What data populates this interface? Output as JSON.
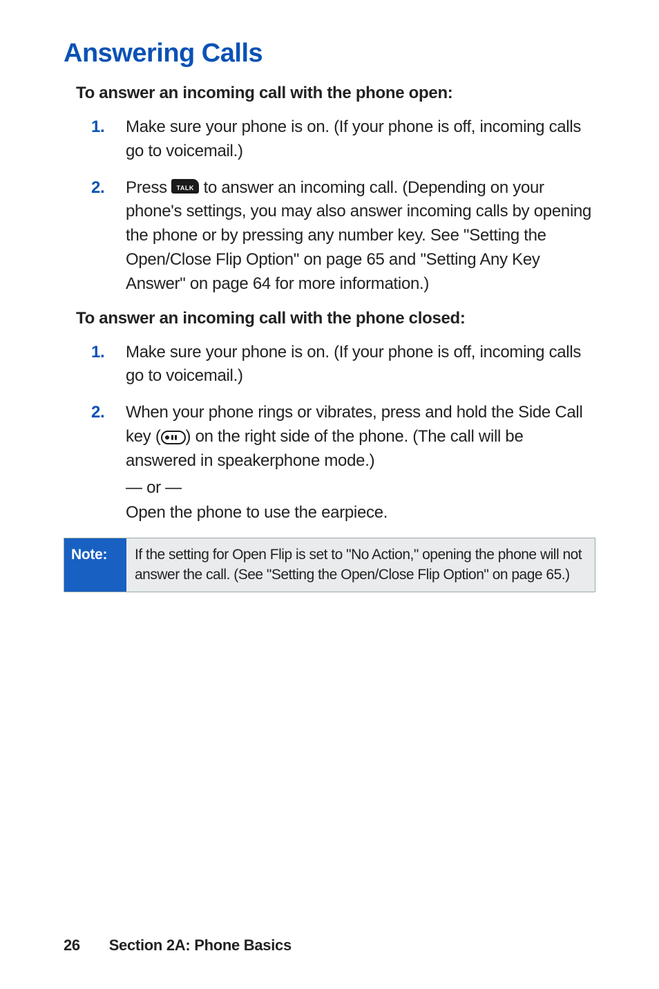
{
  "title": "Answering Calls",
  "sectionA": {
    "heading": "To answer an incoming call with the phone open:",
    "steps": [
      {
        "num": "1.",
        "text": "Make sure your phone is on. (If your phone is off, incoming calls go to voicemail.)"
      },
      {
        "num": "2.",
        "pre": "Press ",
        "post": " to answer an incoming call. (Depending on your phone's settings, you may also answer incoming calls by opening the phone or by pressing any number key. See \"Setting the Open/Close Flip Option\" on page 65 and \"Setting Any Key Answer\" on page 64 for more information.)"
      }
    ]
  },
  "sectionB": {
    "heading": "To answer an incoming call with the phone closed:",
    "steps": [
      {
        "num": "1.",
        "text": "Make sure your phone is on. (If your phone is off, incoming calls go to voicemail.)"
      },
      {
        "num": "2.",
        "pre": "When your phone rings or vibrates, press and hold the Side Call key (",
        "post": ") on the right side of the phone. (The call will be answered in speakerphone mode.)",
        "or": "— or —",
        "after": "Open the phone to use the earpiece."
      }
    ]
  },
  "note": {
    "label": "Note:",
    "body": "If the setting for Open Flip is set to \"No Action,\" opening the phone will not answer the call. (See \"Setting the Open/Close Flip Option\" on page 65.)"
  },
  "footer": {
    "page": "26",
    "section": "Section 2A: Phone Basics"
  }
}
